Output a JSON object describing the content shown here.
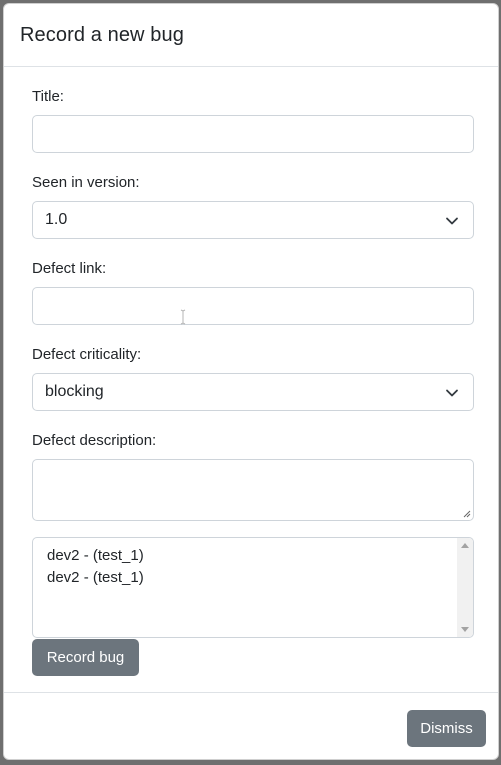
{
  "dialog": {
    "title": "Record a new bug"
  },
  "form": {
    "title_label": "Title:",
    "title_value": "",
    "version_label": "Seen in version:",
    "version_selected": "1.0",
    "defect_link_label": "Defect link:",
    "defect_link_value": "",
    "criticality_label": "Defect criticality:",
    "criticality_selected": "blocking",
    "description_label": "Defect description:",
    "description_value": "",
    "list_items": [
      "dev2 - (test_1)",
      "dev2 - (test_1)"
    ],
    "record_button": "Record bug"
  },
  "footer": {
    "dismiss_button": "Dismiss"
  },
  "icons": {
    "select_arrow": "chevron-down-icon",
    "text_cursor": "i-beam-cursor-icon"
  },
  "colors": {
    "button_bg": "#6c757d",
    "button_text": "#ffffff",
    "border": "#ced4da"
  }
}
